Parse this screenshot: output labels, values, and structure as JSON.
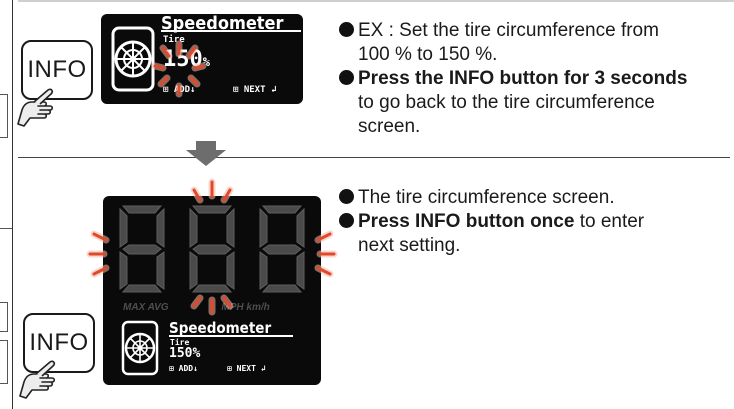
{
  "top_panel": {
    "info_button_label": "INFO",
    "lcd_title": "Speedometer",
    "lcd_field_label": "Tire",
    "lcd_value": "150",
    "lcd_unit": "%",
    "lcd_add_label": "ADD",
    "lcd_next_label": "NEXT",
    "bullets": [
      {
        "lines": [
          "EX : Set the tire circumference from",
          "100 % to 150 %."
        ]
      },
      {
        "bold": "Press the INFO button for 3 seconds",
        "lines": [
          "to go back to the tire circumference",
          "screen."
        ]
      }
    ]
  },
  "bottom_panel": {
    "info_button_label": "INFO",
    "legend_labels": [
      "MAX",
      "AVG",
      "MPH",
      "km/h"
    ],
    "lcd_title": "Speedometer",
    "lcd_field_label": "Tire",
    "lcd_value": "150%",
    "lcd_add_label": "ADD",
    "lcd_next_label": "NEXT",
    "bullets": [
      {
        "lines": [
          "The tire circumference screen."
        ]
      },
      {
        "bold": "Press INFO button once",
        "lines": [
          "next setting."
        ],
        "after_bold": " to enter"
      }
    ]
  },
  "colors": {
    "flash": "#e04a2b",
    "lcd_bg": "#0a0a0a",
    "segment": "#4a4a4a"
  },
  "icons": [
    "hand-pointer-icon",
    "wheel-icon",
    "flash-icon",
    "down-arrow-icon"
  ]
}
